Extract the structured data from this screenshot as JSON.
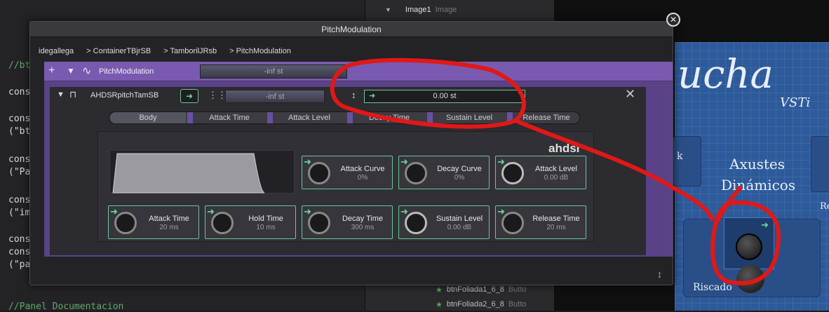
{
  "code": {
    "lines": [
      "//bt",
      "cons",
      "cons",
      "(\"bt",
      "cons",
      "(\"Pa",
      "cons",
      "(\"im",
      "cons",
      "cons",
      "(\"pa",
      "//Panel Documentacion"
    ]
  },
  "tree": {
    "top_item": {
      "name": "Image1",
      "type": "Image"
    },
    "bottom_items": [
      {
        "name": "btnFoliada1_6_8",
        "type": "Butto"
      },
      {
        "name": "btnFoliada2_6_8",
        "type": "Butto"
      }
    ]
  },
  "preview": {
    "title_main": "ucha",
    "title_sub": "VSTi",
    "left_fragment": "k",
    "right_fragment": "Re",
    "heading_line1": "Axustes",
    "heading_line2": "Dinámicos",
    "knob_label": "Riscado"
  },
  "window": {
    "title": "PitchModulation",
    "breadcrumb": [
      "idegallega",
      "> ContainerTBjrSB",
      "> TamborilJRsb",
      "> PitchModulation"
    ],
    "modulator": {
      "name": "PitchModulation",
      "meter": "-inf st"
    },
    "envelope": {
      "name": "AHDSRpitchTamSB",
      "meter": "-inf st",
      "value": "0.00 st"
    },
    "tabs": [
      "Body",
      "Attack Time",
      "Attack Level",
      "Decay Time",
      "Sustain Level",
      "Release Time"
    ],
    "brand": "ahdsr",
    "knobs_top": [
      {
        "name": "Attack Curve",
        "value": "0%"
      },
      {
        "name": "Decay Curve",
        "value": "0%"
      },
      {
        "name": "Attack Level",
        "value": "0.00 dB"
      }
    ],
    "knobs_bottom": [
      {
        "name": "Attack Time",
        "value": "20 ms"
      },
      {
        "name": "Hold Time",
        "value": "10 ms"
      },
      {
        "name": "Decay Time",
        "value": "300 ms"
      },
      {
        "name": "Sustain Level",
        "value": "0.00 dB"
      },
      {
        "name": "Release Time",
        "value": "20 ms"
      }
    ]
  },
  "colors": {
    "accent_green": "#6fc49a",
    "purple": "#7a5ab0",
    "annotation_red": "#e01818"
  }
}
